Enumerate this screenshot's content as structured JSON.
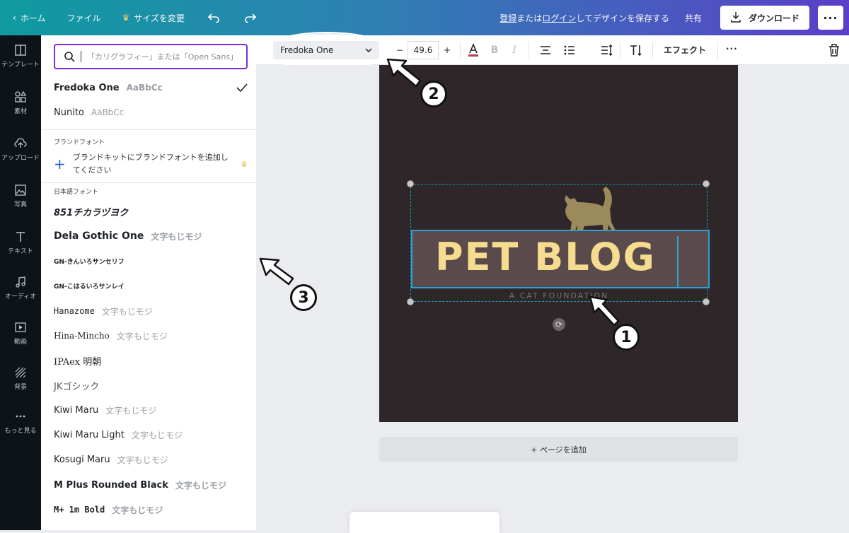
{
  "topbar": {
    "home": "ホーム",
    "file": "ファイル",
    "resize": "サイズを変更",
    "save_prompt": {
      "pre": "",
      "register": "登録",
      "or": "または",
      "login": "ログイン",
      "post": "してデザインを保存する"
    },
    "share": "共有",
    "download": "ダウンロード",
    "more": "···"
  },
  "leftrail": {
    "items": [
      {
        "label": "テンプレート",
        "icon": "template-icon"
      },
      {
        "label": "素材",
        "icon": "shapes-icon"
      },
      {
        "label": "アップロード",
        "icon": "cloud-upload-icon"
      },
      {
        "label": "写真",
        "icon": "photo-icon"
      },
      {
        "label": "テキスト",
        "icon": "text-icon"
      },
      {
        "label": "オーディオ",
        "icon": "music-icon"
      },
      {
        "label": "動画",
        "icon": "video-icon"
      },
      {
        "label": "背景",
        "icon": "background-icon"
      },
      {
        "label": "もっと見る",
        "icon": "more-icon"
      }
    ]
  },
  "fontpanel": {
    "search_placeholder": "「カリグラフィー」または「Open Sans」",
    "recent": [
      {
        "name": "Fredoka One",
        "sample": "AaBbCc",
        "selected": true
      },
      {
        "name": "Nunito",
        "sample": "AaBbCc",
        "selected": false
      }
    ],
    "brand_section": "ブランドフォント",
    "brand_add": "ブランドキットにブランドフォントを追加してください",
    "japanese_section": "日本語フォント",
    "japanese": [
      {
        "name": "851チカラヅヨク",
        "sample": ""
      },
      {
        "name": "Dela Gothic One",
        "sample": "文字もじモジ"
      },
      {
        "name": "GN-きんいろサンセリフ",
        "sample": ""
      },
      {
        "name": "GN-こはるいろサンレイ",
        "sample": ""
      },
      {
        "name": "Hanazome",
        "sample": "文字もじモジ"
      },
      {
        "name": "Hina-Mincho",
        "sample": "文字もじモジ"
      },
      {
        "name": "IPAex 明朝",
        "sample": ""
      },
      {
        "name": "JKゴシック",
        "sample": ""
      },
      {
        "name": "Kiwi Maru",
        "sample": "文字もじモジ"
      },
      {
        "name": "Kiwi Maru Light",
        "sample": "文字もじモジ"
      },
      {
        "name": "Kosugi Maru",
        "sample": "文字もじモジ"
      },
      {
        "name": "M Plus Rounded Black",
        "sample": "文字もじモジ"
      },
      {
        "name": "M+ 1m Bold",
        "sample": "文字もじモジ"
      }
    ]
  },
  "toolbar": {
    "font": "Fredoka One",
    "minus": "−",
    "size": "49.6",
    "plus": "+",
    "effects": "エフェクト",
    "more": "···"
  },
  "canvas": {
    "title": "PET BLOG",
    "subtitle": "A CAT FOUNDATION",
    "add_page": "+ ページを追加"
  },
  "annotations": {
    "one": "1",
    "two": "2",
    "three": "3"
  },
  "colors": {
    "accent": "#7d2ae8",
    "page_bg": "#2e2628",
    "title": "#f6dc8e",
    "selection": "#2ba1d8"
  }
}
